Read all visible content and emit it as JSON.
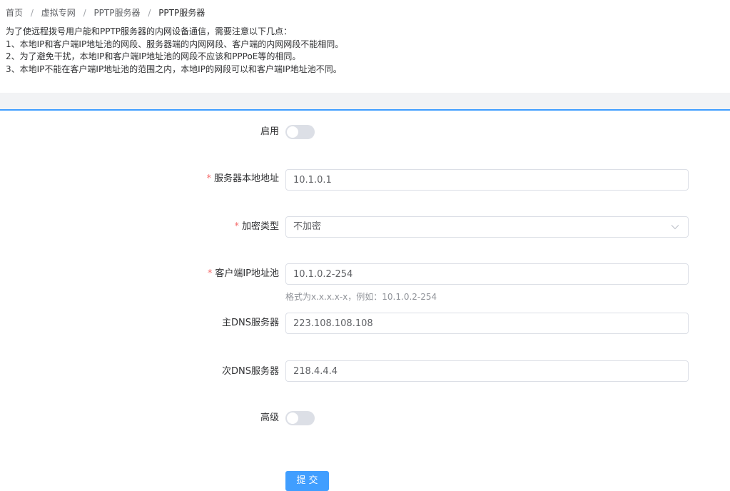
{
  "breadcrumb": {
    "items": [
      "首页",
      "虚拟专网",
      "PPTP服务器",
      "PPTP服务器"
    ],
    "separator": "/"
  },
  "notes": [
    "为了使远程拨号用户能和PPTP服务器的内网设备通信，需要注意以下几点：",
    "1、本地IP和客户端IP地址池的网段、服务器端的内网网段、客户端的内网网段不能相同。",
    "2、为了避免干扰，本地IP和客户端IP地址池的网段不应该和PPPoE等的相同。",
    "3、本地IP不能在客户端IP地址池的范围之内，本地IP的网段可以和客户端IP地址池不同。"
  ],
  "form": {
    "enable": {
      "label": "启用",
      "on": false
    },
    "server_local_ip": {
      "label": "服务器本地地址",
      "value": "10.1.0.1",
      "required": true
    },
    "encryption": {
      "label": "加密类型",
      "value": "不加密",
      "required": true
    },
    "client_ip_pool": {
      "label": "客户端IP地址池",
      "value": "10.1.0.2-254",
      "required": true,
      "hint": "格式为x.x.x.x-x，例如：10.1.0.2-254"
    },
    "primary_dns": {
      "label": "主DNS服务器",
      "value": "223.108.108.108"
    },
    "secondary_dns": {
      "label": "次DNS服务器",
      "value": "218.4.4.4"
    },
    "advanced": {
      "label": "高级",
      "on": false
    },
    "submit_label": "提交"
  },
  "colors": {
    "accent": "#409eff",
    "required_mark": "#f56c6c",
    "switch_off": "#dcdfe6",
    "band": "#f2f3f5"
  },
  "icons": {
    "select_arrow": "chevron-down-icon"
  }
}
